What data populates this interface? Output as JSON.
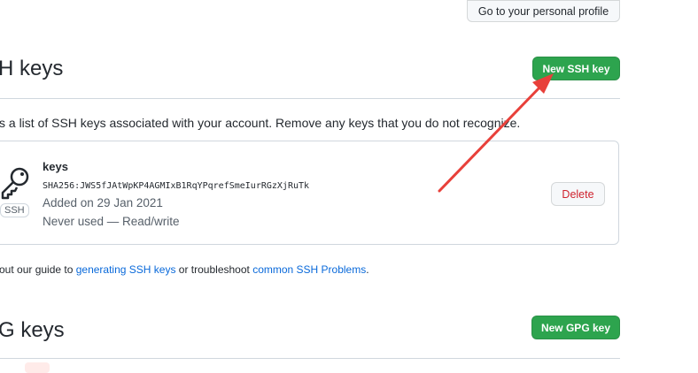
{
  "header": {
    "profile_button": "Go to your personal profile"
  },
  "ssh_section": {
    "title": "H keys",
    "new_button": "New SSH key",
    "description": "s a list of SSH keys associated with your account. Remove any keys that you do not recognize.",
    "key": {
      "title": "keys",
      "fingerprint": "SHA256:JWS5fJAtWpKP4AGMIxB1RqYPqrefSmeIurRGzXjRuTk",
      "added": "Added on 29 Jan 2021",
      "usage": "Never used — Read/write",
      "type_label": "SSH",
      "delete_button": "Delete",
      "icon": "key-icon"
    },
    "guide": {
      "prefix": "out our guide to ",
      "link1": "generating SSH keys",
      "middle": " or troubleshoot ",
      "link2": "common SSH Problems",
      "suffix": "."
    }
  },
  "gpg_section": {
    "title": "G keys",
    "new_button": "New GPG key"
  },
  "annotation": {
    "arrow_color": "#e8403a"
  },
  "colors": {
    "primary_green": "#2da44e",
    "danger_red": "#cf222e",
    "link_blue": "#0969da"
  }
}
